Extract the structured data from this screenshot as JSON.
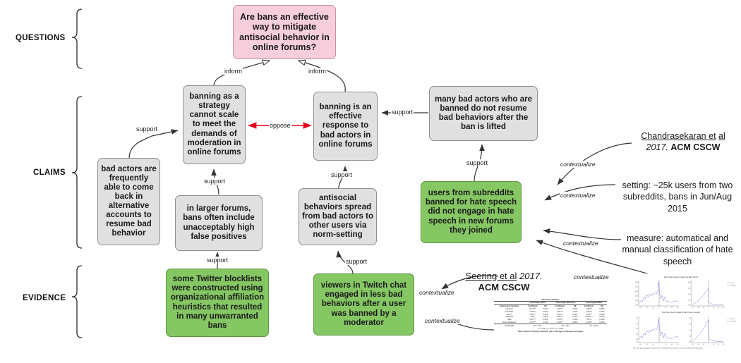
{
  "bands": [
    {
      "id": "questions",
      "label": "QUESTIONS"
    },
    {
      "id": "claims",
      "label": "CLAIMS"
    },
    {
      "id": "evidence",
      "label": "EVIDENCE"
    }
  ],
  "nodes": {
    "question_main": "Are bans an effective way to mitigate antisocial behavior in online forums?",
    "claim_cannot_scale": "banning as a strategy cannot scale to meet the demands of moderation in online forums",
    "claim_effective": "banning is an effective response to bad actors in online forums",
    "claim_many_bad_actors": "many bad actors who are banned do not resume bad behaviors after the ban is lifted",
    "claim_bad_actors_return": "bad actors are frequently able to come back in alternative accounts to resume bad behavior",
    "claim_false_positives": "in larger forums, bans often include unacceptably high false positives",
    "claim_norm_setting": "antisocial behaviors spread from bad actors to other users via norm-setting",
    "evidence_twitter_blocklists": "some Twitter blocklists were constructed using organizational affiliation heuristics that resulted in many unwarranted bans",
    "evidence_twitch": "viewers in Twitch chat engaged in less bad behaviors after a user was banned by a moderator",
    "evidence_subreddits": "users from subreddits banned for hate speech did not engage in hate speech in new forums they joined"
  },
  "edges": [
    {
      "id": "inform-left",
      "label": "inform",
      "kind": "inform"
    },
    {
      "id": "inform-right",
      "label": "inform",
      "kind": "inform"
    },
    {
      "id": "oppose",
      "label": "oppose",
      "kind": "oppose"
    },
    {
      "id": "support-bad-actors-to-cannot-scale",
      "label": "support",
      "kind": "support"
    },
    {
      "id": "support-false-positives-to-cannot-scale",
      "label": "support",
      "kind": "support"
    },
    {
      "id": "support-many-bad-actors-to-effective",
      "label": "support",
      "kind": "support"
    },
    {
      "id": "support-norm-setting-to-effective",
      "label": "support",
      "kind": "support"
    },
    {
      "id": "support-twitter-to-false-positives",
      "label": "support",
      "kind": "support"
    },
    {
      "id": "support-twitch-to-norm-setting",
      "label": "support",
      "kind": "support"
    },
    {
      "id": "support-subreddits-to-many-bad-actors",
      "label": "support",
      "kind": "support"
    },
    {
      "id": "contextualize-chandrasekaran",
      "label": "contextualize",
      "kind": "contextualize"
    },
    {
      "id": "contextualize-setting",
      "label": "contextualize",
      "kind": "contextualize"
    },
    {
      "id": "contextualize-measure",
      "label": "contextualize",
      "kind": "contextualize"
    },
    {
      "id": "contextualize-figure",
      "label": "contextualize",
      "kind": "contextualize"
    },
    {
      "id": "contextualize-seering",
      "label": "contextualize",
      "kind": "contextualize"
    },
    {
      "id": "contextualize-table",
      "label": "contextualize",
      "kind": "contextualize"
    }
  ],
  "citations": {
    "chandrasekaran": {
      "authors": "Chandrasekaran et",
      "authors2": "al",
      "year": "2017.",
      "venue": "ACM CSCW"
    },
    "seering": {
      "authors": "Seering et al",
      "year": "2017.",
      "venue": "ACM CSCW"
    }
  },
  "notes": {
    "setting": "setting: ~25k users from two subreddits, bans in Jun/Aug 2015",
    "measure": "measure: automatical and manual classification of hate speech"
  },
  "colors": {
    "question_fill": "#f8cedd",
    "claim_fill": "#e0e0e0",
    "evidence_fill": "#85c763",
    "oppose_edge": "#e8001c",
    "default_edge": "#333333",
    "chart_line": "#6a6ad8"
  },
  "table_thumbnail": {
    "group_header": "Dependent Variables",
    "col_groups": [
      "Percentage Spam",
      "Percentage Questions",
      "Percentage Smiles"
    ],
    "sub_headers": [
      "Independent Variables",
      "Coefficient",
      "SE",
      "Coefficient",
      "SE",
      "Coefficient",
      "SE"
    ],
    "rows": [
      [
        "Intercept",
        "13.7%***",
        "0.01%",
        "4.7%***",
        "0.03%",
        "1.0%***",
        "0.00%"
      ],
      [
        "PrevState",
        "3.6%***",
        "0.06%",
        "2.2%***",
        "0.07%",
        "2.0%***",
        "0.01%"
      ],
      [
        "Event*",
        "4.4%***",
        "0.05%",
        "2.6%***",
        "0.02%",
        "2.2%***",
        "0.00%"
      ],
      [
        "isBanned",
        "0.1%",
        "0.09%",
        "0.6%***",
        "0.04%",
        "0.07%***",
        "0.02%"
      ],
      [
        "Rate",
        "0.2%***",
        "0.06%",
        "-0.2%***",
        "0.00%",
        "-0.1%",
        "0.00%"
      ],
      [
        "Event*isBanned",
        "-4.7%***",
        "0.13%",
        "-1.6%***",
        "0.02%",
        "-2.0%**",
        "0.20%"
      ]
    ],
    "footer_n": "N=203,636",
    "footer_r2": [
      "R² = 0.04",
      "R² = 0.11",
      "R² = 0.06"
    ],
    "footer_sig": "* p < 0.05  ** p < 0.01  *** p < 0.001",
    "caption": "Table 6: Impact of banning a particular type of message on subsequent messages"
  },
  "chart_data": {
    "type": "line",
    "title": "Mean Hate Speech Usage By Ban Period",
    "subtitle": "Total Hate Speech Usage By Ban Period (in words)",
    "panels": [
      {
        "id": "p1",
        "legend": [
          "Control",
          "Treatment"
        ],
        "x": [
          -60,
          -50,
          -40,
          -30,
          -20,
          -10,
          0,
          10,
          20,
          30,
          40,
          50,
          60
        ],
        "series": [
          {
            "name": "Treatment",
            "values": [
              0.004,
              0.005,
              0.006,
              0.005,
              0.007,
              0.006,
              0.01,
              0.004,
              0.003,
              0.002,
              0.002,
              0.002,
              0.002
            ]
          }
        ]
      },
      {
        "id": "p2",
        "legend": [
          "Control",
          "Treatment"
        ],
        "x": [
          -60,
          -40,
          -20,
          0,
          20,
          40,
          60
        ],
        "series": [
          {
            "name": "Treatment",
            "values": [
              0.001,
              0.002,
              0.003,
              0.005,
              0.001,
              0.0,
              0.0
            ]
          }
        ]
      },
      {
        "id": "p3",
        "legend": [
          "Control",
          "Treatment"
        ],
        "x": [
          -60,
          -40,
          -20,
          0,
          20,
          40,
          60
        ],
        "series": [
          {
            "name": "Treatment",
            "values": [
              0.03,
              0.04,
              0.05,
              0.06,
              0.02,
              0.015,
              0.02
            ]
          }
        ]
      },
      {
        "id": "p4",
        "legend": [
          "Control",
          "Treatment"
        ],
        "x": [
          -60,
          -40,
          -20,
          0,
          20,
          40,
          60
        ],
        "series": [
          {
            "name": "Treatment",
            "values": [
              0.01,
              0.02,
              0.03,
              0.05,
              0.01,
              0.005,
              0.005
            ]
          }
        ]
      }
    ],
    "caption": "Fig. 1: Hate speech usage per hate speech user over 60 days before and after the ban, for the treatment and control groups.",
    "xlabel": "Days relative to ban",
    "ylabel": "Hate speech usage",
    "grid": false,
    "legend_position": "right"
  }
}
